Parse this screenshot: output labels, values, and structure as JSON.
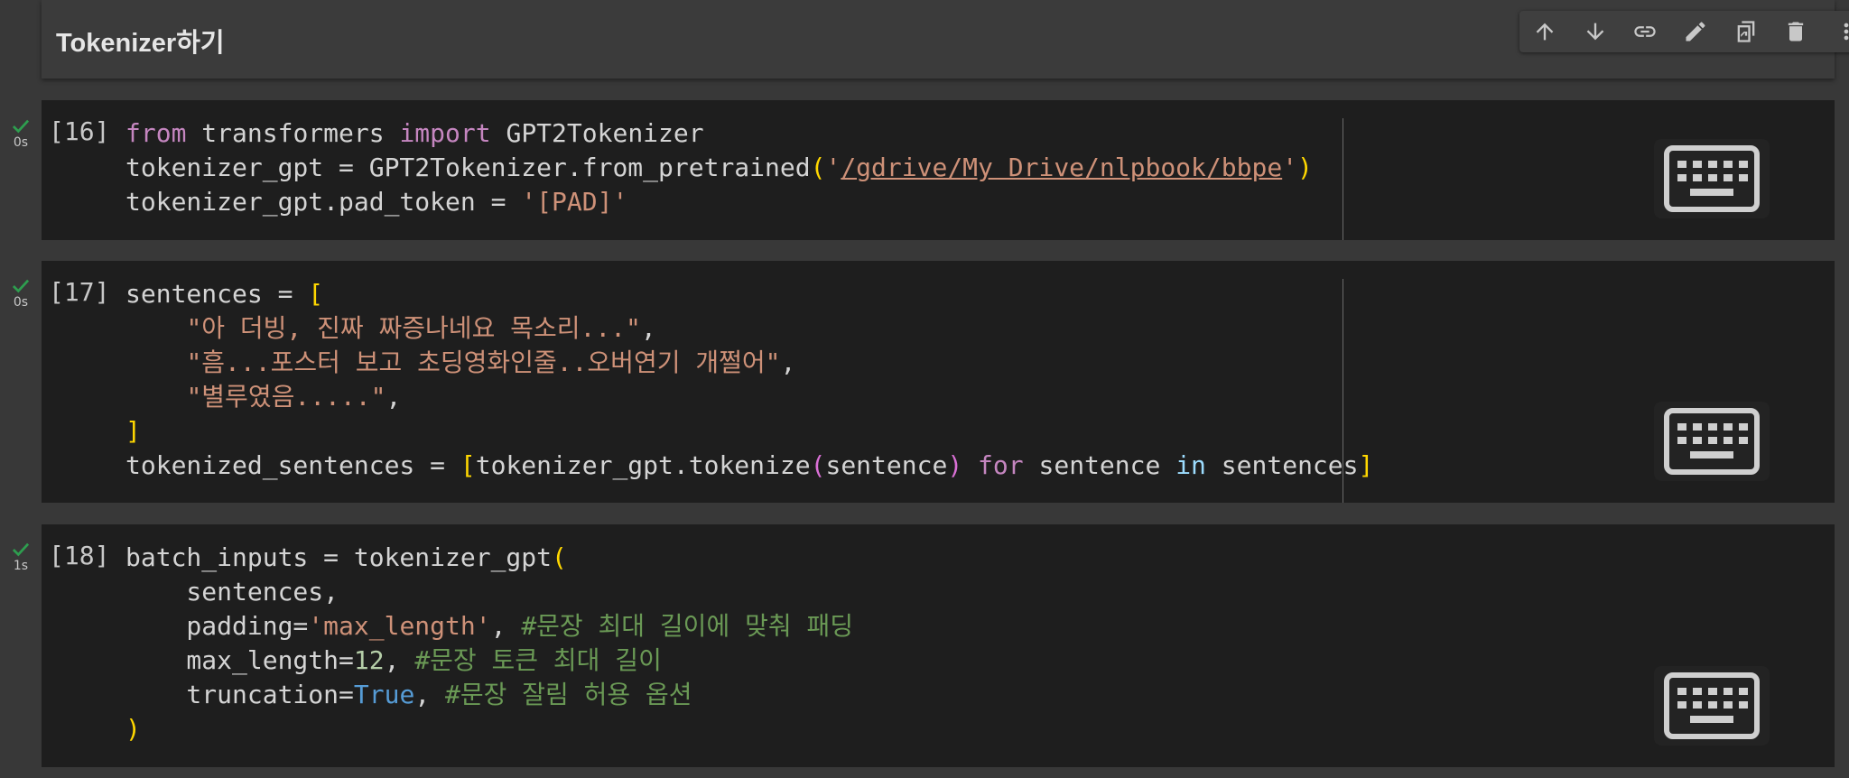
{
  "text_cell": {
    "heading": "Tokenizer하기",
    "toolbar": [
      {
        "name": "move-cell-up-button",
        "icon": "arrow-up-icon"
      },
      {
        "name": "move-cell-down-button",
        "icon": "arrow-down-icon"
      },
      {
        "name": "link-to-cell-button",
        "icon": "link-icon"
      },
      {
        "name": "edit-cell-button",
        "icon": "pencil-icon"
      },
      {
        "name": "mirror-cell-button",
        "icon": "mirror-icon"
      },
      {
        "name": "delete-cell-button",
        "icon": "trash-icon"
      },
      {
        "name": "more-actions-button",
        "icon": "more-vert-icon"
      }
    ]
  },
  "cells": [
    {
      "exec_count": "[16]",
      "run_time": "0s",
      "status": "success",
      "tokens": [
        [
          [
            "kw",
            "from"
          ],
          [
            "",
            "transformers"
          ],
          [
            "kw",
            "import"
          ],
          [
            "",
            "GPT2Tokenizer"
          ]
        ],
        [
          [
            "",
            "tokenizer_gpt = GPT2Tokenizer.from_pretrained"
          ],
          [
            "p1",
            "("
          ],
          [
            "str",
            "'"
          ],
          [
            "link",
            "/gdrive/My Drive/nlpbook/bbpe"
          ],
          [
            "str",
            "'"
          ],
          [
            "p1",
            ")"
          ]
        ],
        [
          [
            "",
            "tokenizer_gpt.pad_token = "
          ],
          [
            "str",
            "'[PAD]'"
          ]
        ]
      ]
    },
    {
      "exec_count": "[17]",
      "run_time": "0s",
      "status": "success",
      "tokens": [
        [
          [
            "",
            "sentences = "
          ],
          [
            "p1",
            "["
          ]
        ],
        [
          [
            "",
            "    "
          ],
          [
            "str",
            "\"아 더빙, 진짜 짜증나네요 목소리...\""
          ],
          [
            "",
            ","
          ]
        ],
        [
          [
            "",
            "    "
          ],
          [
            "str",
            "\"흠...포스터 보고 초딩영화인줄..오버연기 개쩔어\""
          ],
          [
            "",
            ","
          ]
        ],
        [
          [
            "",
            "    "
          ],
          [
            "str",
            "\"별루였음.....\""
          ],
          [
            "",
            ","
          ]
        ],
        [
          [
            "p1",
            "]"
          ]
        ],
        [
          [
            "",
            "tokenized_sentences = "
          ],
          [
            "p1",
            "["
          ],
          [
            "",
            "tokenizer_gpt.tokenize"
          ],
          [
            "p2",
            "("
          ],
          [
            "",
            "sentence"
          ],
          [
            "p2",
            ")"
          ],
          [
            "kw",
            " for"
          ],
          [
            "",
            " sentence "
          ],
          [
            "in",
            "in"
          ],
          [
            "",
            " sentences"
          ],
          [
            "p1",
            "]"
          ]
        ]
      ]
    },
    {
      "exec_count": "[18]",
      "run_time": "1s",
      "status": "success",
      "tokens": [
        [
          [
            "",
            "batch_inputs = tokenizer_gpt"
          ],
          [
            "p1",
            "("
          ]
        ],
        [
          [
            "",
            "    sentences,"
          ]
        ],
        [
          [
            "",
            "    padding="
          ],
          [
            "str",
            "'max_length'"
          ],
          [
            "",
            ", "
          ],
          [
            "cm",
            "#문장 최대 길이에 맞춰 패딩"
          ]
        ],
        [
          [
            "",
            "    max_length="
          ],
          [
            "num",
            "12"
          ],
          [
            "",
            ", "
          ],
          [
            "cm",
            "#문장 토큰 최대 길이"
          ]
        ],
        [
          [
            "",
            "    truncation="
          ],
          [
            "bi",
            "True"
          ],
          [
            "",
            ", "
          ],
          [
            "cm",
            "#문장 잘림 허용 옵션"
          ]
        ],
        [
          [
            "p1",
            ")"
          ]
        ]
      ]
    }
  ]
}
